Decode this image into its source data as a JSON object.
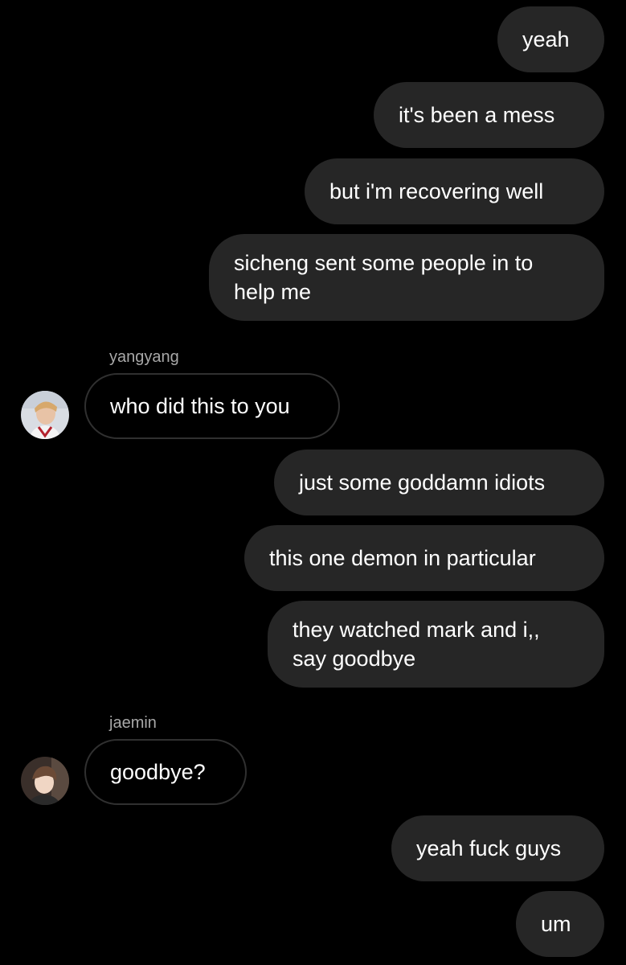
{
  "thread": {
    "messages": [
      {
        "direction": "outgoing",
        "text": "yeah"
      },
      {
        "direction": "outgoing",
        "text": "it's been a mess"
      },
      {
        "direction": "outgoing",
        "text": "but i'm recovering well"
      },
      {
        "direction": "outgoing",
        "lines": [
          "sicheng sent some people in to",
          "help me"
        ]
      },
      {
        "direction": "incoming",
        "sender": "yangyang",
        "text": "who did this to you",
        "avatar_icon": "profile-photo-icon"
      },
      {
        "direction": "outgoing",
        "text": "just some goddamn idiots"
      },
      {
        "direction": "outgoing",
        "text": "this one demon in particular"
      },
      {
        "direction": "outgoing",
        "lines": [
          "they watched mark and i,,",
          "say goodbye"
        ]
      },
      {
        "direction": "incoming",
        "sender": "jaemin",
        "text": "goodbye?",
        "avatar_icon": "profile-photo-icon"
      },
      {
        "direction": "outgoing",
        "text": "yeah fuck guys"
      },
      {
        "direction": "outgoing",
        "text": "um"
      }
    ]
  },
  "colors": {
    "background": "#000000",
    "outgoing_bubble": "#262626",
    "incoming_border": "#303030",
    "sender_label": "#a8a8a8",
    "text": "#ffffff"
  }
}
